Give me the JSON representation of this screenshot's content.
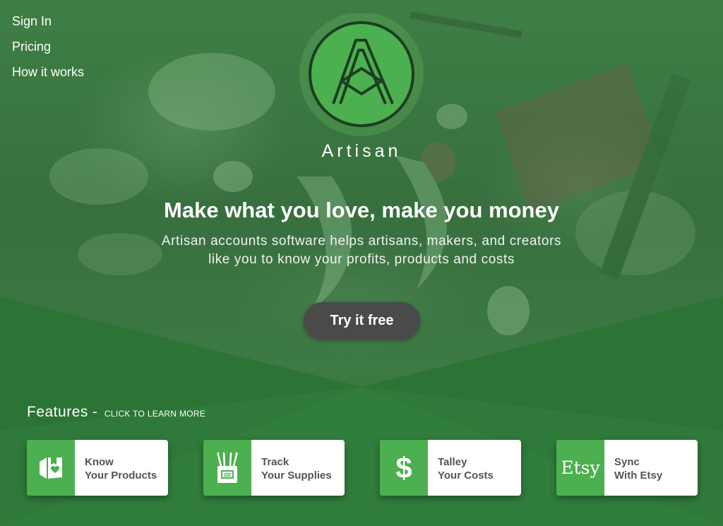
{
  "nav": {
    "items": [
      {
        "label": "Sign In"
      },
      {
        "label": "Pricing"
      },
      {
        "label": "How it works"
      }
    ]
  },
  "brand": {
    "name": "Artisan",
    "logo_icon": "artisan-a-logo"
  },
  "hero": {
    "headline": "Make what you love, make you money",
    "subline_1": "Artisan accounts software helps artisans, makers, and creators",
    "subline_2": "like you to know your profits, products and costs",
    "cta_label": "Try it free"
  },
  "features": {
    "title": "Features",
    "separator": "-",
    "hint": "CLICK TO LEARN MORE",
    "cards": [
      {
        "icon": "box-heart-icon",
        "line1": "Know",
        "line2": "Your Products"
      },
      {
        "icon": "pencil-cup-icon",
        "line1": "Track",
        "line2": "Your Supplies"
      },
      {
        "icon": "dollar-icon",
        "glyph": "$",
        "line1": "Talley",
        "line2": "Your Costs"
      },
      {
        "icon": "etsy-icon",
        "glyph": "Etsy",
        "line1": "Sync",
        "line2": "With Etsy"
      }
    ]
  },
  "colors": {
    "accent": "#4caf50",
    "dark_green": "#2e6f38",
    "cta_bg": "#4a4a4a",
    "card_text": "#555555"
  }
}
